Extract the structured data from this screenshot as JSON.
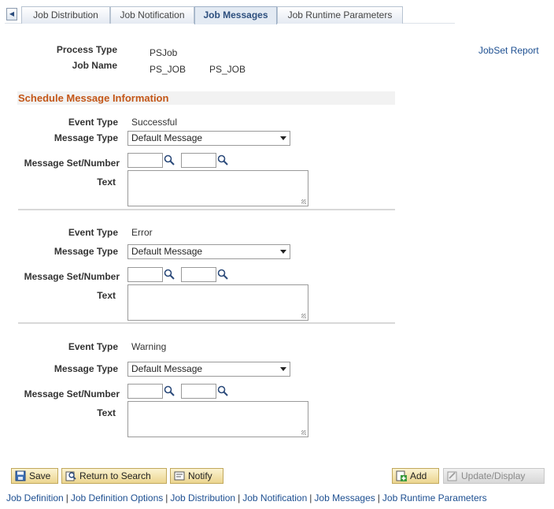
{
  "tabs": [
    {
      "label": "Job Distribution"
    },
    {
      "label": "Job Notification"
    },
    {
      "label": "Job Messages"
    },
    {
      "label": "Job Runtime Parameters"
    }
  ],
  "header": {
    "process_type_label": "Process Type",
    "process_type_value": "PSJob",
    "job_name_label": "Job Name",
    "job_name_value": "PS_JOB",
    "job_name_value2": "PS_JOB",
    "jobset_report_link": "JobSet Report"
  },
  "section": {
    "title": "Schedule Message Information"
  },
  "labels": {
    "event_type": "Event Type",
    "message_type": "Message Type",
    "message_set_number": "Message Set/Number",
    "text": "Text"
  },
  "messages": [
    {
      "event_type": "Successful",
      "message_type": "Default Message",
      "message_set": "",
      "message_number": "",
      "text": ""
    },
    {
      "event_type": "Error",
      "message_type": "Default Message",
      "message_set": "",
      "message_number": "",
      "text": ""
    },
    {
      "event_type": "Warning",
      "message_type": "Default Message",
      "message_set": "",
      "message_number": "",
      "text": ""
    }
  ],
  "buttons": {
    "save": "Save",
    "return_to_search": "Return to Search",
    "notify": "Notify",
    "add": "Add",
    "update_display": "Update/Display"
  },
  "footer_links": [
    "Job Definition",
    "Job Definition Options",
    "Job Distribution",
    "Job Notification",
    "Job Messages",
    "Job Runtime Parameters"
  ],
  "footer_separator": "|",
  "colors": {
    "section_title": "#c35617",
    "link": "#1d4f91",
    "active_tab_text": "#2d4f7e"
  },
  "icons": {
    "tab_scroll": "chevron-left-icon",
    "lookup": "magnifier-icon",
    "save": "save-icon",
    "return_to_search": "search-return-icon",
    "notify": "notify-icon",
    "add": "add-icon",
    "update_display": "update-display-icon"
  }
}
